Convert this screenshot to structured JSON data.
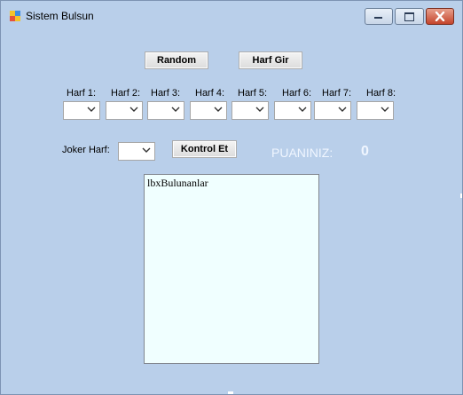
{
  "window": {
    "title": "Sistem Bulsun"
  },
  "buttons": {
    "random": "Random",
    "harf_gir": "Harf Gir",
    "kontrol_et": "Kontrol Et"
  },
  "harf_labels": [
    "Harf 1:",
    "Harf 2:",
    "Harf 3:",
    "Harf 4:",
    "Harf 5:",
    "Harf 6:",
    "Harf 7:",
    "Harf 8:"
  ],
  "joker": {
    "label": "Joker Harf:"
  },
  "score": {
    "label": "PUANINIZ:",
    "value": "0"
  },
  "listbox": {
    "name": "lbxBulunanlar"
  }
}
